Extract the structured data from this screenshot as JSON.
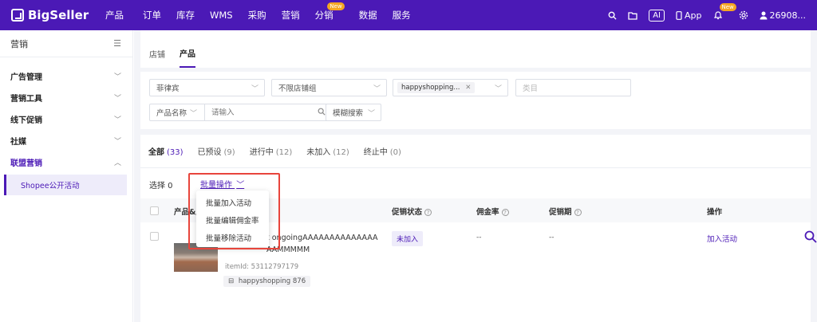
{
  "topbar": {
    "logo_text": "BigSeller",
    "nav": [
      {
        "label": "产品"
      },
      {
        "label": "订单"
      },
      {
        "label": "库存"
      },
      {
        "label": "WMS"
      },
      {
        "label": "采购"
      },
      {
        "label": "营销"
      },
      {
        "label": "分销",
        "badge": "New"
      },
      {
        "label": "数据"
      },
      {
        "label": "服务"
      }
    ],
    "ai_label": "AI",
    "app_label": "App",
    "notification_badge": "New",
    "user_label": "26908..."
  },
  "sidebar": {
    "title": "营销",
    "items": [
      {
        "label": "广告管理"
      },
      {
        "label": "营销工具"
      },
      {
        "label": "线下促销"
      },
      {
        "label": "社媒"
      },
      {
        "label": "联盟营销"
      }
    ],
    "sub_item": "Shopee公开活动"
  },
  "page_tabs": [
    "店铺",
    "产品"
  ],
  "filters": {
    "site": "菲律宾",
    "shop_group": "不限店铺组",
    "shop_chip": "happyshopping...",
    "category_placeholder": "类目",
    "product_name_label": "产品名称",
    "search_placeholder": "请输入",
    "fuzzy_label": "模糊搜索"
  },
  "status_tabs": [
    {
      "label": "全部",
      "count": "(33)"
    },
    {
      "label": "已预设",
      "count": "(9)"
    },
    {
      "label": "进行中",
      "count": "(12)"
    },
    {
      "label": "未加入",
      "count": "(12)"
    },
    {
      "label": "终止中",
      "count": "(0)"
    }
  ],
  "selection": {
    "label": "选择 0",
    "batch_label": "批量操作"
  },
  "table": {
    "columns": {
      "product": "产品&店",
      "status": "促销状态",
      "commission": "佣金率",
      "period": "促销期",
      "action": "操作"
    },
    "rows": [
      {
        "name_line1": "t ongoingAAAAAAAAAAAAAA",
        "name_line2": "AAMMMMM",
        "item_id": "itemId: 53112797179",
        "shop": "happyshopping 876",
        "status": "未加入",
        "commission": "--",
        "period": "--",
        "action": "加入活动"
      }
    ]
  },
  "dropdown": {
    "items": [
      "批量加入活动",
      "批量编辑佣金率",
      "批量移除活动"
    ]
  },
  "colors": {
    "brand": "#4b19b6",
    "highlight": "#e8453c"
  }
}
